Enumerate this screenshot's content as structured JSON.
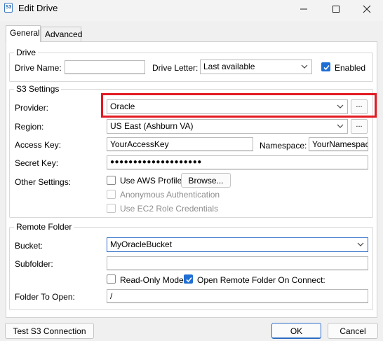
{
  "window": {
    "title": "Edit Drive",
    "app_icon_text": "S3"
  },
  "tabs": [
    {
      "label": "General"
    },
    {
      "label": "Advanced"
    }
  ],
  "drive": {
    "legend": "Drive",
    "name_label": "Drive Name:",
    "name_value": "",
    "letter_label": "Drive Letter:",
    "letter_value": "Last available",
    "enabled_label": "Enabled",
    "enabled_checked": true
  },
  "s3": {
    "legend": "S3 Settings",
    "provider_label": "Provider:",
    "provider_value": "Oracle",
    "provider_more": "...",
    "region_label": "Region:",
    "region_value": "US East (Ashburn VA)",
    "region_more": "...",
    "access_key_label": "Access Key:",
    "access_key_value": "YourAccessKey",
    "namespace_label": "Namespace:",
    "namespace_value": "YourNamespace",
    "secret_key_label": "Secret Key:",
    "secret_key_value": "●●●●●●●●●●●●●●●●●●●●",
    "other_settings_label": "Other Settings:",
    "use_aws_profile_label": "Use AWS Profile",
    "browse_label": "Browse...",
    "anonymous_label": "Anonymous Authentication",
    "ec2_label": "Use EC2 Role Credentials"
  },
  "remote": {
    "legend": "Remote Folder",
    "bucket_label": "Bucket:",
    "bucket_value": "MyOracleBucket",
    "subfolder_label": "Subfolder:",
    "subfolder_value": "",
    "readonly_label": "Read-Only Mode",
    "open_on_connect_label": "Open Remote Folder On Connect:",
    "open_on_connect_checked": true,
    "folder_to_open_label": "Folder To Open:",
    "folder_to_open_value": "/"
  },
  "footer": {
    "test_label": "Test S3 Connection",
    "ok_label": "OK",
    "cancel_label": "Cancel"
  },
  "colors": {
    "accent": "#1f6ed4",
    "highlight": "#e21a22"
  }
}
